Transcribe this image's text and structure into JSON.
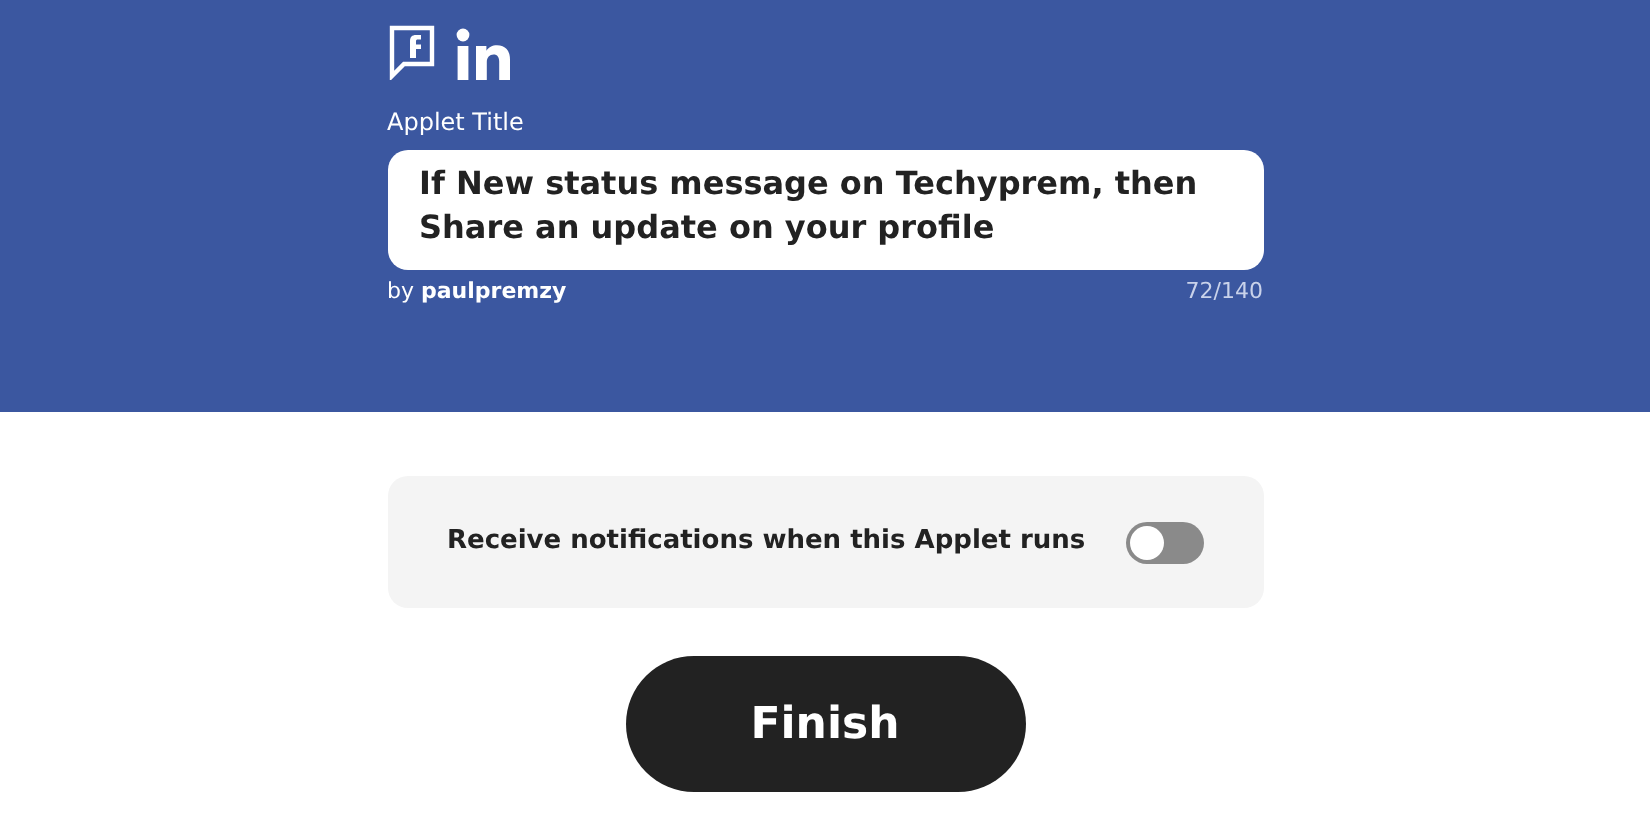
{
  "header": {
    "field_label": "Applet Title",
    "title_value": "If New status message on Techyprem, then Share an update on your profile",
    "author": "by **paulpremzy**",
    "char_count": "72/140"
  },
  "notification": {
    "label": "Receive notifications when this Applet runs",
    "on": false
  },
  "finish_button": {
    "label": "Finish"
  }
}
